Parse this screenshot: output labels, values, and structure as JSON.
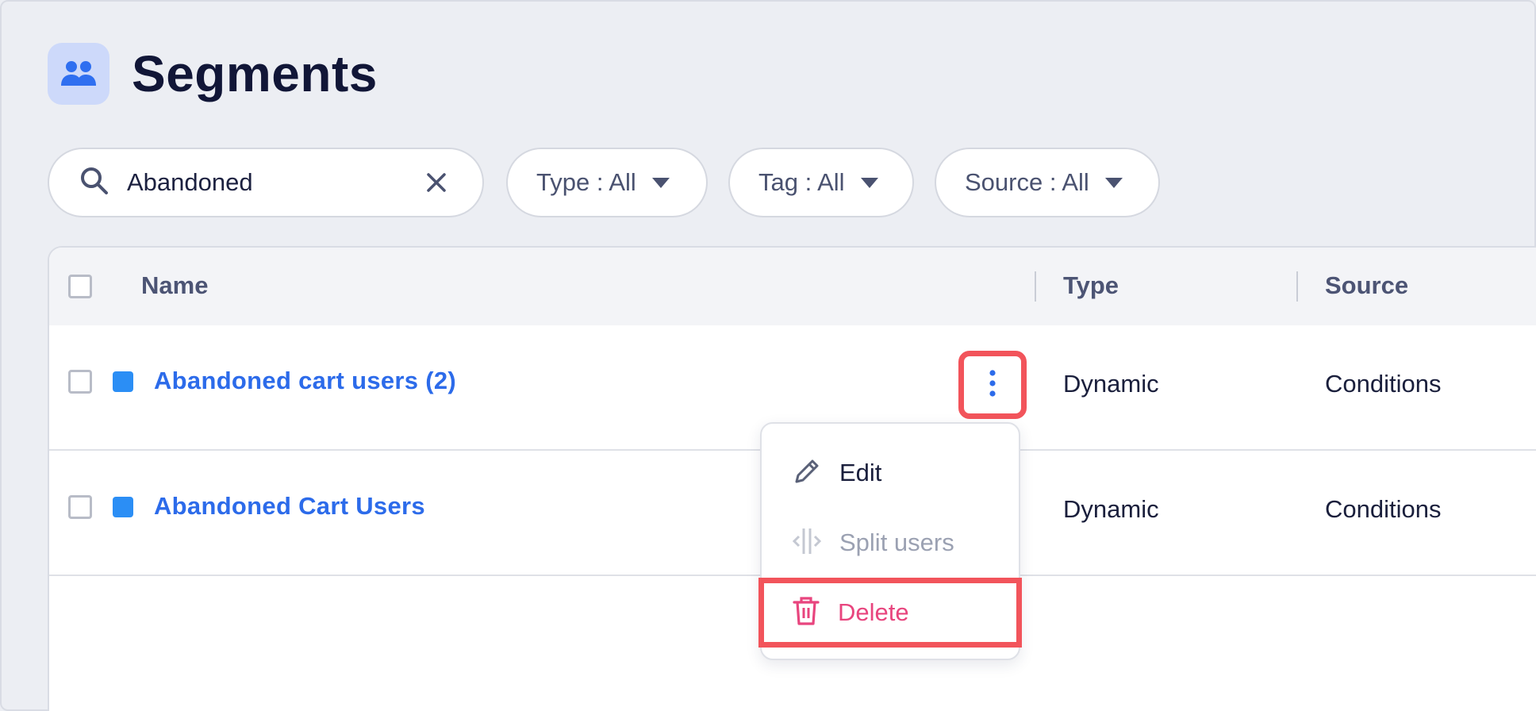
{
  "page": {
    "title": "Segments",
    "icon": "users-group-icon"
  },
  "search": {
    "value": "Abandoned",
    "icon": "search-icon",
    "clear_icon": "close-icon"
  },
  "filters": [
    {
      "label": "Type : All",
      "icon": "caret-down-icon"
    },
    {
      "label": "Tag : All",
      "icon": "caret-down-icon"
    },
    {
      "label": "Source : All",
      "icon": "caret-down-icon"
    }
  ],
  "table": {
    "columns": [
      "Name",
      "Type",
      "Source"
    ],
    "rows": [
      {
        "name": "Abandoned cart users (2)",
        "type": "Dynamic",
        "source": "Conditions",
        "color": "#2b8ef5"
      },
      {
        "name": "Abandoned Cart Users",
        "type": "Dynamic",
        "source": "Conditions",
        "color": "#2b8ef5"
      }
    ]
  },
  "context_menu": {
    "items": [
      {
        "label": "Edit",
        "icon": "pencil-icon",
        "enabled": true
      },
      {
        "label": "Split users",
        "icon": "split-icon",
        "enabled": false
      },
      {
        "label": "Delete",
        "icon": "trash-icon",
        "enabled": true,
        "highlighted": true
      }
    ]
  },
  "colors": {
    "accent": "#2c6bea",
    "highlight": "#f2545b",
    "danger": "#e8457e",
    "icon_bg": "#cdd9fa"
  }
}
